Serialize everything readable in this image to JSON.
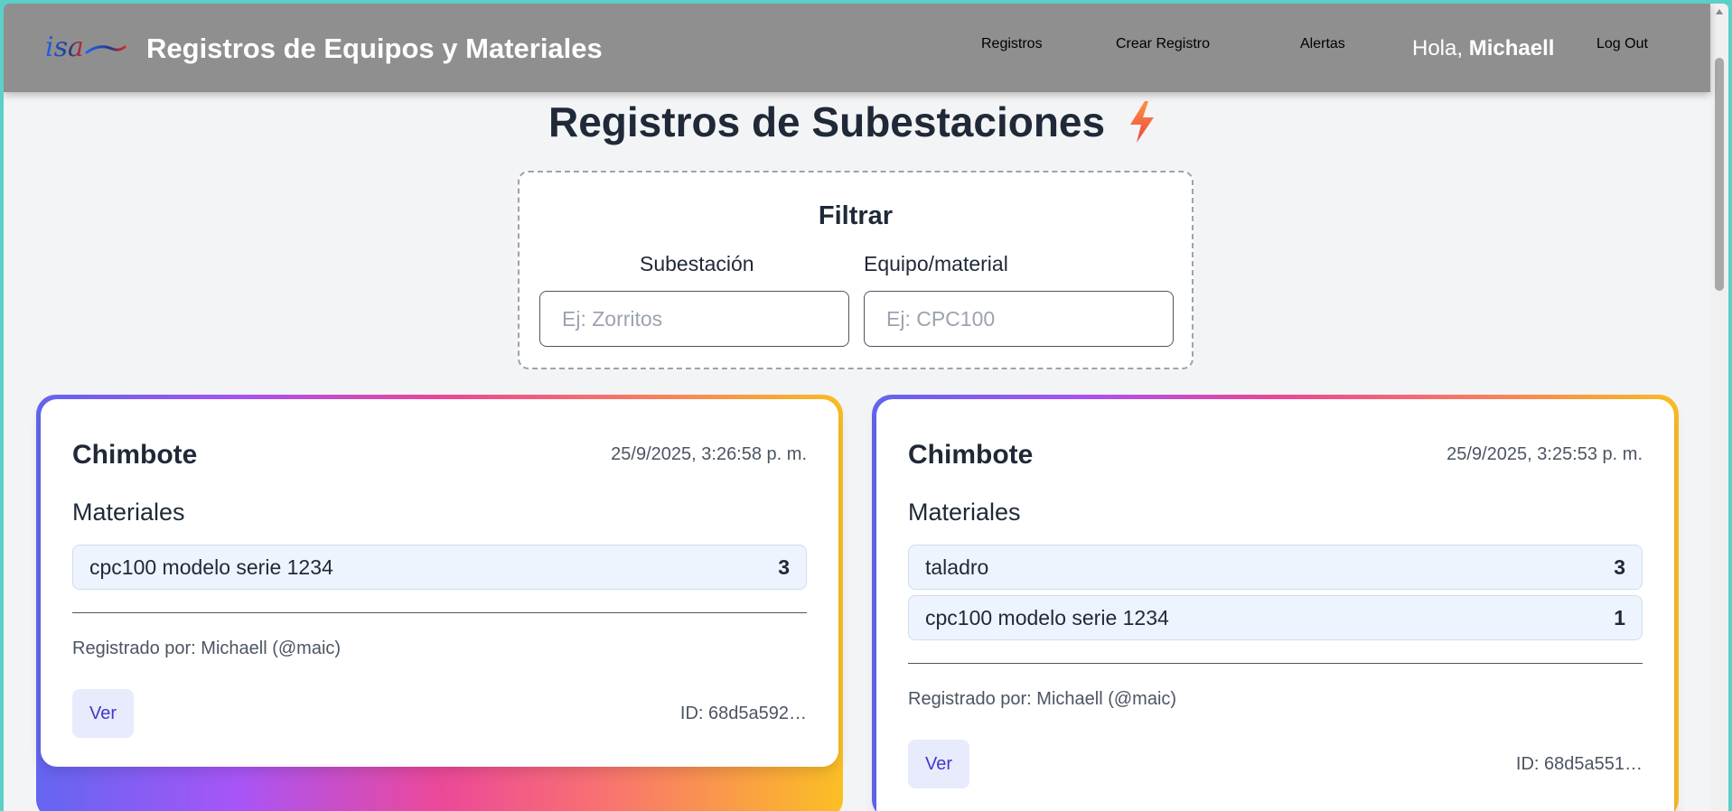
{
  "header": {
    "title": "Registros de Equipos y Materiales",
    "nav": {
      "registros": "Registros",
      "crear": "Crear Registro",
      "alertas": "Alertas",
      "greeting_prefix": "Hola, ",
      "user": "Michaell",
      "logout": "Log Out"
    }
  },
  "page": {
    "title": "Registros de Subestaciones"
  },
  "filter": {
    "title": "Filtrar",
    "subestacion_label": "Subestación",
    "subestacion_placeholder": "Ej: Zorritos",
    "equipo_label": "Equipo/material",
    "equipo_placeholder": "Ej: CPC100"
  },
  "records": [
    {
      "name": "Chimbote",
      "date": "25/9/2025, 3:26:58 p. m.",
      "section": "Materiales",
      "items": [
        {
          "label": "cpc100 modelo serie 1234",
          "qty": "3"
        }
      ],
      "registered_by": "Registrado por: Michaell (@maic)",
      "button": "Ver",
      "id": "ID: 68d5a592…"
    },
    {
      "name": "Chimbote",
      "date": "25/9/2025, 3:25:53 p. m.",
      "section": "Materiales",
      "items": [
        {
          "label": "taladro",
          "qty": "3"
        },
        {
          "label": "cpc100 modelo serie 1234",
          "qty": "1"
        }
      ],
      "registered_by": "Registrado por: Michaell (@maic)",
      "button": "Ver",
      "id": "ID: 68d5a551…"
    }
  ],
  "colors": {
    "header_bg": "#8f8f90",
    "page_bg": "#f3f4f6",
    "accent_button": "#4338ca",
    "gradient": [
      "#6366f1",
      "#a855f7",
      "#ec4899",
      "#f87171",
      "#fbbf24"
    ]
  },
  "icons": {
    "logo": "isa-logo",
    "title_icon": "lightning-bolt-icon"
  }
}
